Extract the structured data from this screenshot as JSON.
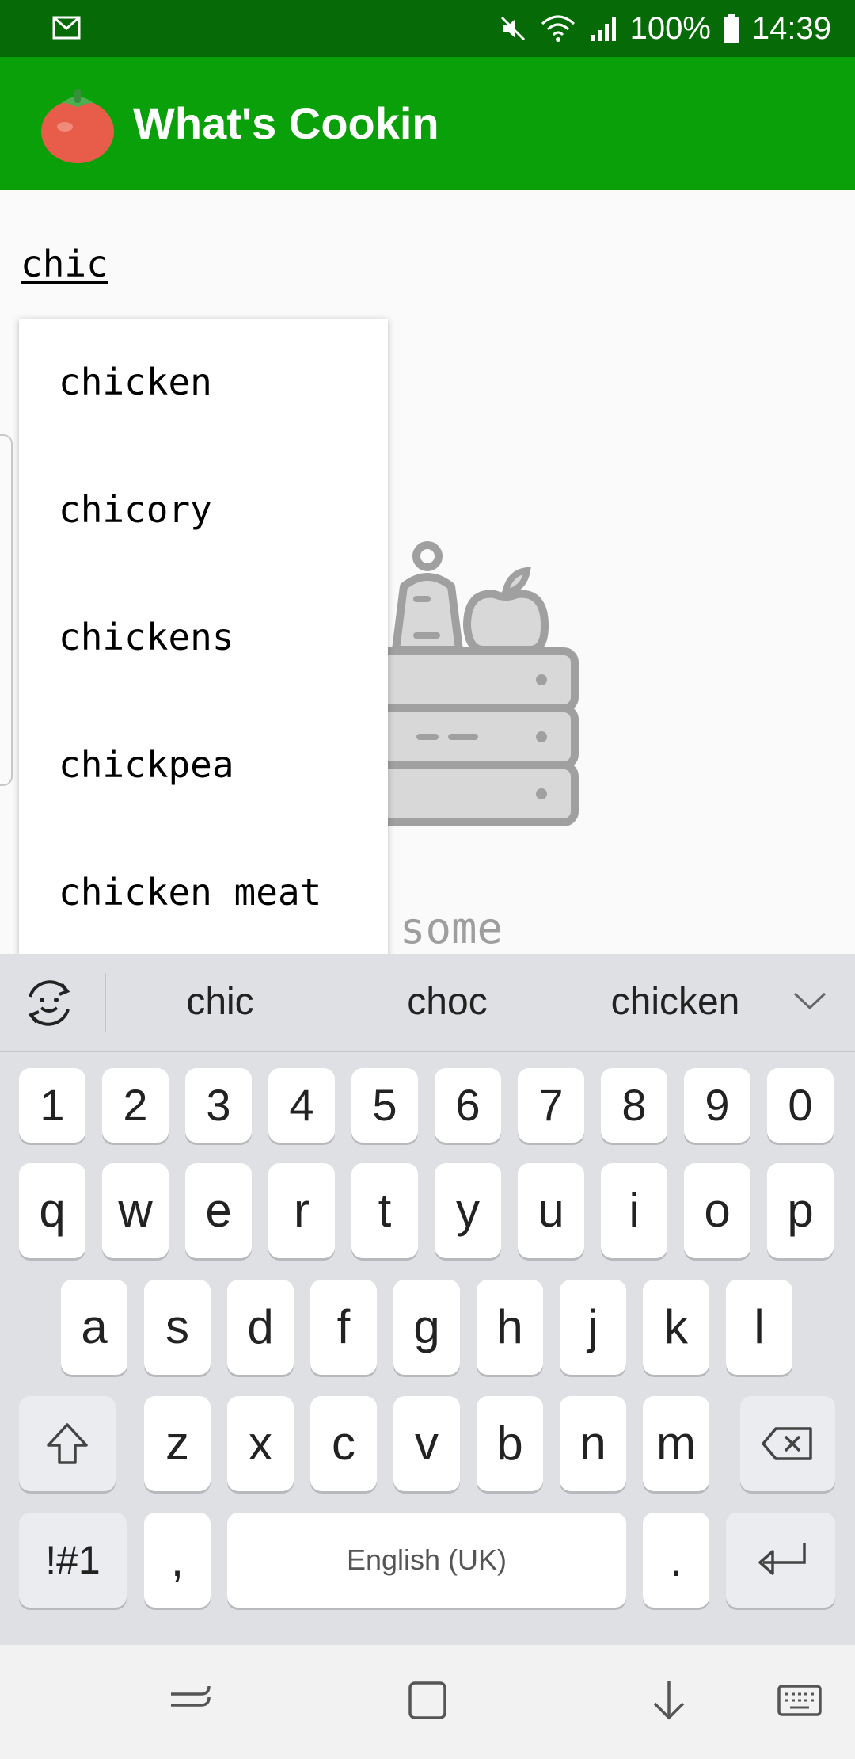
{
  "status_bar": {
    "battery_percent": "100%",
    "time": "14:39",
    "icons": [
      "gmail-notification-icon",
      "mute-icon",
      "wifi-icon",
      "signal-icon",
      "battery-icon"
    ]
  },
  "app_bar": {
    "title": "What's Cookin",
    "logo_icon": "tomato-icon",
    "background_color": "#0aa00a"
  },
  "search": {
    "value": "chic"
  },
  "autocomplete": {
    "items": [
      "chicken",
      "chicory",
      "chickens",
      "chickpea",
      "chicken meat"
    ]
  },
  "empty_state": {
    "illustration_icon": "vegetable-crate-icon",
    "text_visible": "d some"
  },
  "keyboard": {
    "suggestions": [
      "chic",
      "choc",
      "chicken"
    ],
    "row_numbers": [
      "1",
      "2",
      "3",
      "4",
      "5",
      "6",
      "7",
      "8",
      "9",
      "0"
    ],
    "row_1": [
      "q",
      "w",
      "e",
      "r",
      "t",
      "y",
      "u",
      "i",
      "o",
      "p"
    ],
    "row_2": [
      "a",
      "s",
      "d",
      "f",
      "g",
      "h",
      "j",
      "k",
      "l"
    ],
    "row_3": [
      "z",
      "x",
      "c",
      "v",
      "b",
      "n",
      "m"
    ],
    "symbols_label": "!#1",
    "comma_label": ",",
    "space_label": "English (UK)",
    "period_label": "."
  },
  "nav_bar": {
    "icons": [
      "back-icon",
      "home-icon",
      "hide-keyboard-icon",
      "keyboard-switch-icon"
    ]
  }
}
